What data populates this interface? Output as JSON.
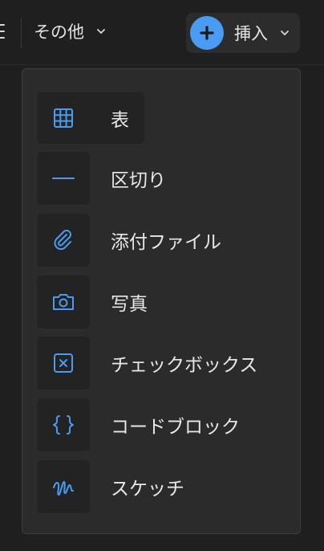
{
  "toolbar": {
    "more_label": "その他",
    "insert_label": "挿入",
    "accent": "#4a9cf2"
  },
  "insert_menu": {
    "items": [
      {
        "label": "表",
        "icon": "table-icon"
      },
      {
        "label": "区切り",
        "icon": "divider-line-icon"
      },
      {
        "label": "添付ファイル",
        "icon": "paperclip-icon"
      },
      {
        "label": "写真",
        "icon": "camera-icon"
      },
      {
        "label": "チェックボックス",
        "icon": "checkbox-icon"
      },
      {
        "label": "コードブロック",
        "icon": "code-braces-icon"
      },
      {
        "label": "スケッチ",
        "icon": "sketch-squiggle-icon"
      }
    ]
  }
}
